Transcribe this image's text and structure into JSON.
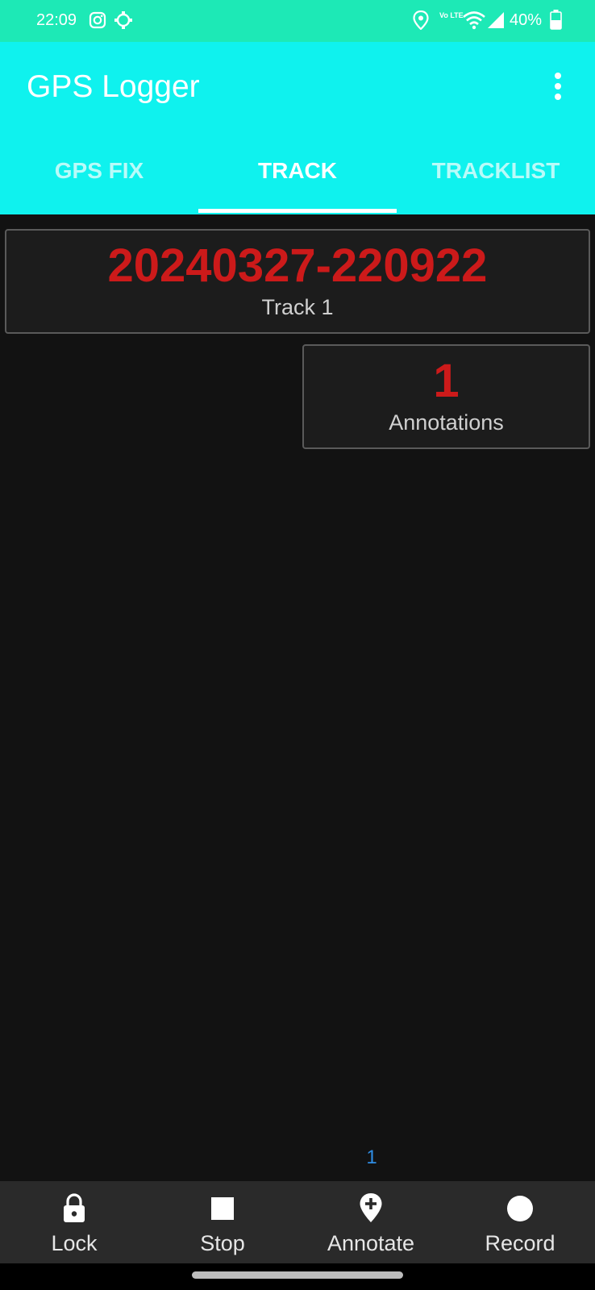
{
  "status_bar": {
    "time": "22:09",
    "volte": "Vo LTE",
    "battery": "40%"
  },
  "app_bar": {
    "title": "GPS Logger"
  },
  "tabs": [
    {
      "label": "GPS FIX",
      "active": false
    },
    {
      "label": "TRACK",
      "active": true
    },
    {
      "label": "TRACKLIST",
      "active": false
    }
  ],
  "track_card": {
    "value": "20240327-220922",
    "label": "Track 1"
  },
  "annotations_card": {
    "value": "1",
    "label": "Annotations"
  },
  "page_indicator": "1",
  "bottom_actions": [
    {
      "label": "Lock",
      "icon": "lock-icon"
    },
    {
      "label": "Stop",
      "icon": "stop-icon"
    },
    {
      "label": "Annotate",
      "icon": "add-location-icon"
    },
    {
      "label": "Record",
      "icon": "record-icon"
    }
  ],
  "colors": {
    "status_bar_bg": "#1de9b6",
    "app_bar_bg": "#0ff2ee",
    "value_red": "#cc1a1a",
    "page_indicator_blue": "#2f8de4",
    "background": "#121212"
  }
}
